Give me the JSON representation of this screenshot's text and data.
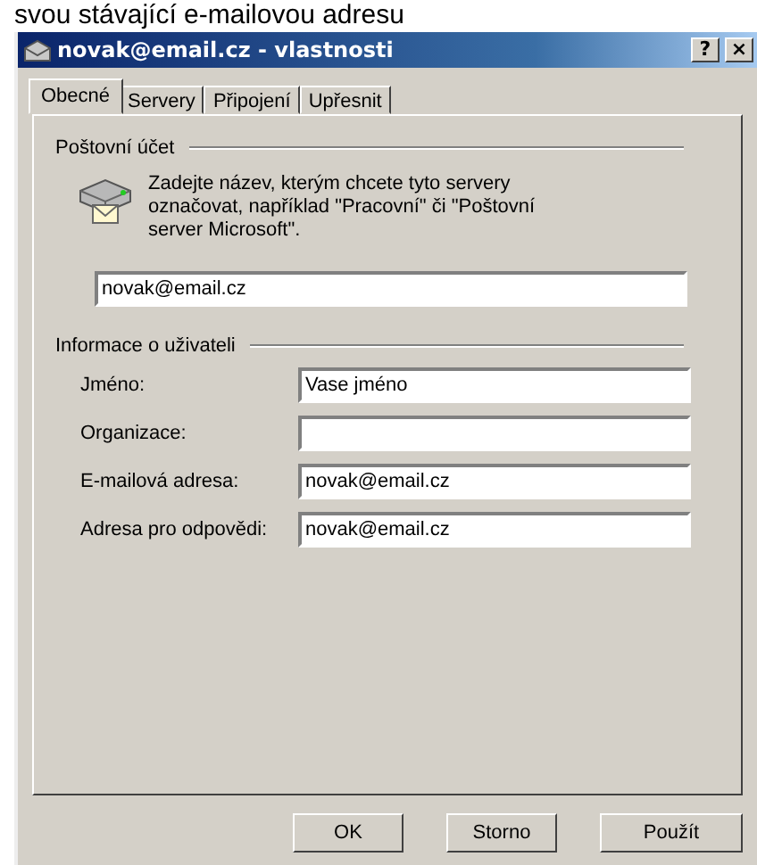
{
  "caption": "svou stávající e-mailovou adresu",
  "window": {
    "title": "novak@email.cz - vlastnosti",
    "help_button": "?",
    "close_button": "×"
  },
  "tabs": [
    {
      "label": "Obecné",
      "selected": true
    },
    {
      "label": "Servery",
      "selected": false
    },
    {
      "label": "Připojení",
      "selected": false
    },
    {
      "label": "Upřesnit",
      "selected": false
    }
  ],
  "mail_account": {
    "heading": "Poštovní účet",
    "description": "Zadejte název, kterým chcete tyto servery označovat, například \"Pracovní\" či \"Poštovní server Microsoft\".",
    "account_name": "novak@email.cz"
  },
  "user_info": {
    "heading": "Informace o uživateli",
    "fields": [
      {
        "label": "Jméno:",
        "value": "Vase jméno"
      },
      {
        "label": "Organizace:"
      },
      {
        "label": "E-mailová adresa:",
        "value": "novak@email.cz"
      },
      {
        "label": "Adresa pro odpovědi:",
        "value": "novak@email.cz"
      }
    ]
  },
  "buttons": [
    "OK",
    "Storno",
    "Použít"
  ]
}
